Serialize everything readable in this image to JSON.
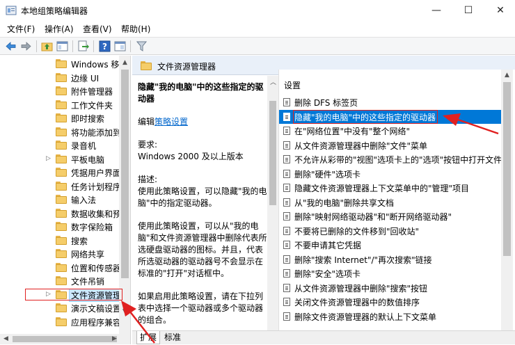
{
  "window": {
    "title": "本地组策略编辑器",
    "min_label": "—",
    "max_label": "☐",
    "close_label": "✕"
  },
  "menu": [
    "文件(F)",
    "操作(A)",
    "查看(V)",
    "帮助(H)"
  ],
  "toolbar_icons": [
    "back-arrow-icon",
    "forward-arrow-icon",
    "up-folder-icon",
    "show-tree-icon",
    "export-icon",
    "help-icon",
    "properties-icon",
    "filter-icon"
  ],
  "tree": {
    "items": [
      {
        "label": "Windows 移",
        "expandable": false
      },
      {
        "label": "边缘 UI",
        "expandable": false
      },
      {
        "label": "附件管理器",
        "expandable": false
      },
      {
        "label": "工作文件夹",
        "expandable": false
      },
      {
        "label": "即时搜索",
        "expandable": false
      },
      {
        "label": "将功能添加到",
        "expandable": false
      },
      {
        "label": "录音机",
        "expandable": false
      },
      {
        "label": "平板电脑",
        "expandable": true
      },
      {
        "label": "凭据用户界面",
        "expandable": false
      },
      {
        "label": "任务计划程序",
        "expandable": false
      },
      {
        "label": "输入法",
        "expandable": false
      },
      {
        "label": "数据收集和预",
        "expandable": false
      },
      {
        "label": "数字保险箱",
        "expandable": false
      },
      {
        "label": "搜索",
        "expandable": false
      },
      {
        "label": "网络共享",
        "expandable": false
      },
      {
        "label": "位置和传感器",
        "expandable": false
      },
      {
        "label": "文件吊销",
        "expandable": false
      },
      {
        "label": "文件资源管理",
        "expandable": true,
        "selected": true
      },
      {
        "label": "演示文稿设置",
        "expandable": false
      },
      {
        "label": "应用程序兼容",
        "expandable": false
      }
    ]
  },
  "right": {
    "header_title": "文件资源管理器",
    "desc": {
      "title": "隐藏\"我的电脑\"中的这些指定的驱动器",
      "edit_prefix": "编辑",
      "edit_link": "策略设置",
      "req_label": "要求:",
      "req_value": "Windows 2000 及以上版本",
      "desc_label": "描述:",
      "p1": "使用此策略设置，可以隐藏\"我的电脑\"中的指定驱动器。",
      "p2": "使用此策略设置，可以从\"我的电脑\"和文件资源管理器中删除代表所选硬盘驱动器的图标。并且，代表所选驱动器的驱动器号不会显示在标准的\"打开\"对话框中。",
      "p3": "如果启用此策略设置，请在下拉列表中选择一个驱动器或多个驱动器的组合。"
    },
    "list_header": "设置",
    "settings": [
      "删除 DFS 标签页",
      "隐藏\"我的电脑\"中的这些指定的驱动器",
      "在\"网络位置\"中没有\"整个网络\"",
      "从文件资源管理器中删除\"文件\"菜单",
      "不允许从彩带的\"视图\"选项卡上的\"选项\"按钮中打开文件夹",
      "删除\"硬件\"选项卡",
      "隐藏文件资源管理器上下文菜单中的\"管理\"项目",
      "从\"我的电脑\"删除共享文档",
      "删除\"映射网络驱动器\"和\"断开网络驱动器\"",
      "不要将已删除的文件移到\"回收站\"",
      "不要申请其它凭据",
      "删除\"搜索 Internet\"/\"再次搜索\"链接",
      "删除\"安全\"选项卡",
      "从文件资源管理器中删除\"搜索\"按钮",
      "关闭文件资源管理器中的数值排序",
      "删除文件资源管理器的默认上下文菜单"
    ],
    "selected_index": 1,
    "tabs": [
      "扩展",
      "标准"
    ]
  }
}
